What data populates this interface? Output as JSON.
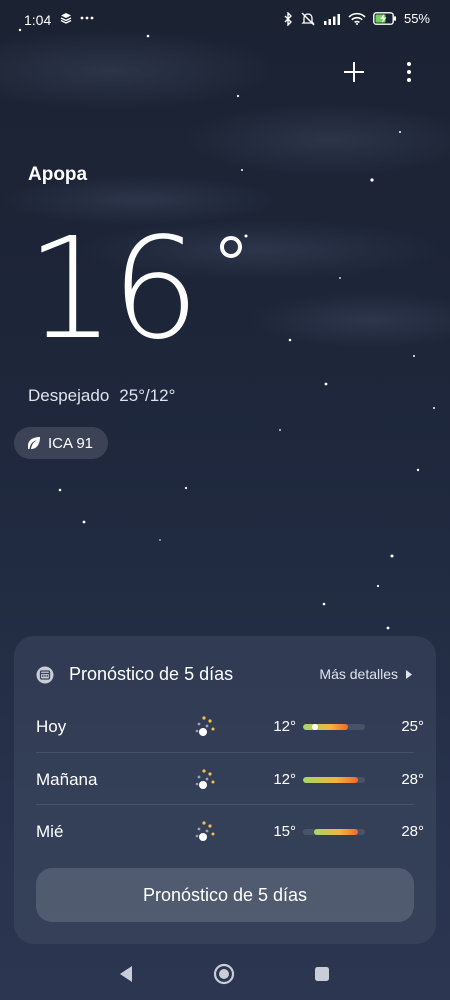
{
  "status_bar": {
    "time": "1:04",
    "battery_percent": "55%"
  },
  "location": {
    "city": "Apopa"
  },
  "current": {
    "temperature": "16",
    "condition": "Despejado",
    "high_low": "25°/12°",
    "aqi_label": "ICA 91"
  },
  "forecast_card": {
    "title": "Pronóstico de 5 días",
    "more_details": "Más detalles",
    "button_label": "Pronóstico de 5 días",
    "days": [
      {
        "label": "Hoy",
        "low": "12°",
        "high": "25°",
        "icon": "clear-night-icon",
        "bar_start": 0.0,
        "bar_end": 0.72,
        "now_position": 0.2
      },
      {
        "label": "Mañana",
        "low": "12°",
        "high": "28°",
        "icon": "clear-night-icon",
        "bar_start": 0.0,
        "bar_end": 0.88
      },
      {
        "label": "Mié",
        "low": "15°",
        "high": "28°",
        "icon": "clear-night-icon",
        "bar_start": 0.18,
        "bar_end": 0.88
      }
    ]
  },
  "colors": {
    "bar_low": "#a5d86a",
    "bar_mid": "#f2b340",
    "bar_high": "#f06a2d",
    "bar_track": "#4a5268"
  },
  "icons": {
    "status_left": [
      "layers-icon",
      "more-dots-icon"
    ],
    "status_right": [
      "bluetooth-icon",
      "mute-alarm-icon",
      "signal-icon",
      "wifi-icon",
      "battery-charging-icon"
    ],
    "top_actions": [
      "add-icon",
      "more-vertical-icon"
    ],
    "aqi": "leaf-icon",
    "card_header": "calendar-icon",
    "nav": [
      "back-triangle-icon",
      "home-circle-icon",
      "recents-square-icon"
    ]
  }
}
